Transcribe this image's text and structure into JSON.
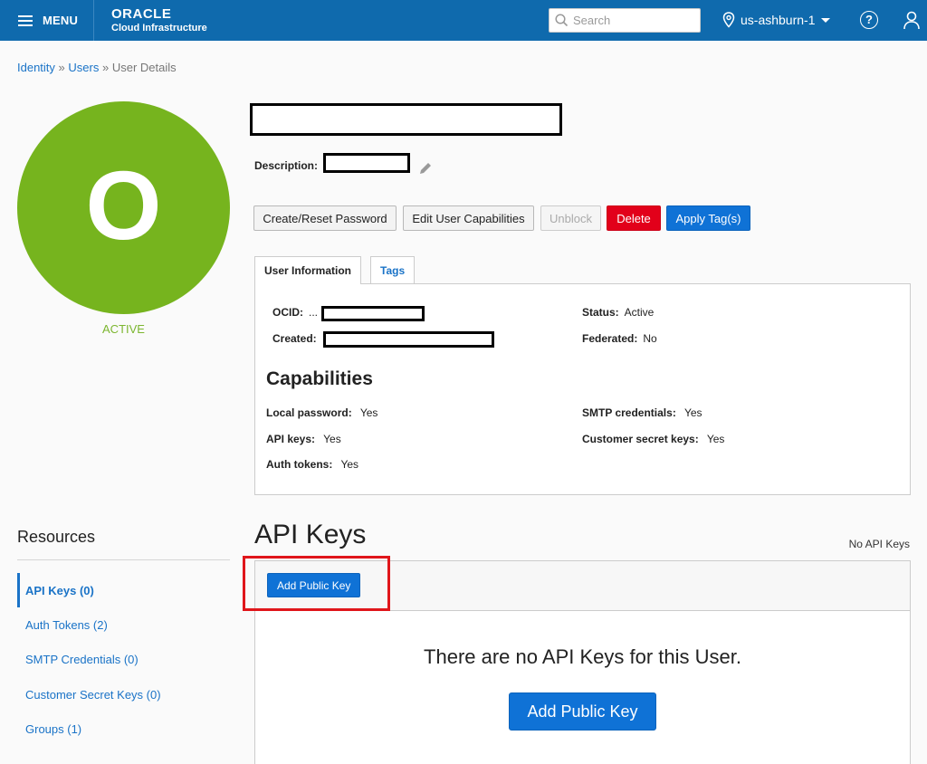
{
  "topbar": {
    "menu_label": "MENU",
    "logo_title": "ORACLE",
    "logo_subtitle": "Cloud Infrastructure",
    "search_placeholder": "Search",
    "region": "us-ashburn-1",
    "help_glyph": "?"
  },
  "breadcrumb": {
    "items": [
      "Identity",
      "Users",
      "User Details"
    ],
    "separator": "»"
  },
  "user": {
    "avatar_letter": "O",
    "avatar_color": "#76b41e",
    "status": "ACTIVE",
    "description_label": "Description:"
  },
  "actions": {
    "create_reset_password": "Create/Reset Password",
    "edit_capabilities": "Edit User Capabilities",
    "unblock": "Unblock",
    "delete": "Delete",
    "apply_tags": "Apply Tag(s)"
  },
  "tabs": [
    "User Information",
    "Tags"
  ],
  "info": {
    "ocid_label": "OCID:",
    "ocid_prefix": "...",
    "created_label": "Created:",
    "status_label": "Status:",
    "status_value": "Active",
    "federated_label": "Federated:",
    "federated_value": "No"
  },
  "capabilities": {
    "title": "Capabilities",
    "local_password_label": "Local password:",
    "local_password_value": "Yes",
    "api_keys_label": "API keys:",
    "api_keys_value": "Yes",
    "auth_tokens_label": "Auth tokens:",
    "auth_tokens_value": "Yes",
    "smtp_label": "SMTP credentials:",
    "smtp_value": "Yes",
    "customer_secret_label": "Customer secret keys:",
    "customer_secret_value": "Yes"
  },
  "resources": {
    "title": "Resources",
    "items": [
      "API Keys (0)",
      "Auth Tokens (2)",
      "SMTP Credentials (0)",
      "Customer Secret Keys (0)",
      "Groups (1)"
    ]
  },
  "api_keys": {
    "title": "API Keys",
    "count_text": "No API Keys",
    "add_button": "Add Public Key",
    "empty_message": "There are no API Keys for this User.",
    "empty_add_button": "Add Public Key"
  },
  "colors": {
    "brand_blue": "#0f6aad",
    "primary": "#0f72d6",
    "danger": "#e2001a",
    "active_green": "#76b41e",
    "highlight_red": "#e0161b"
  },
  "icons": {
    "menu": "hamburger-icon",
    "search": "search-icon",
    "region": "location-pin-icon",
    "caret": "caret-down-icon",
    "help": "help-icon",
    "user": "user-icon",
    "edit": "pencil-icon"
  }
}
